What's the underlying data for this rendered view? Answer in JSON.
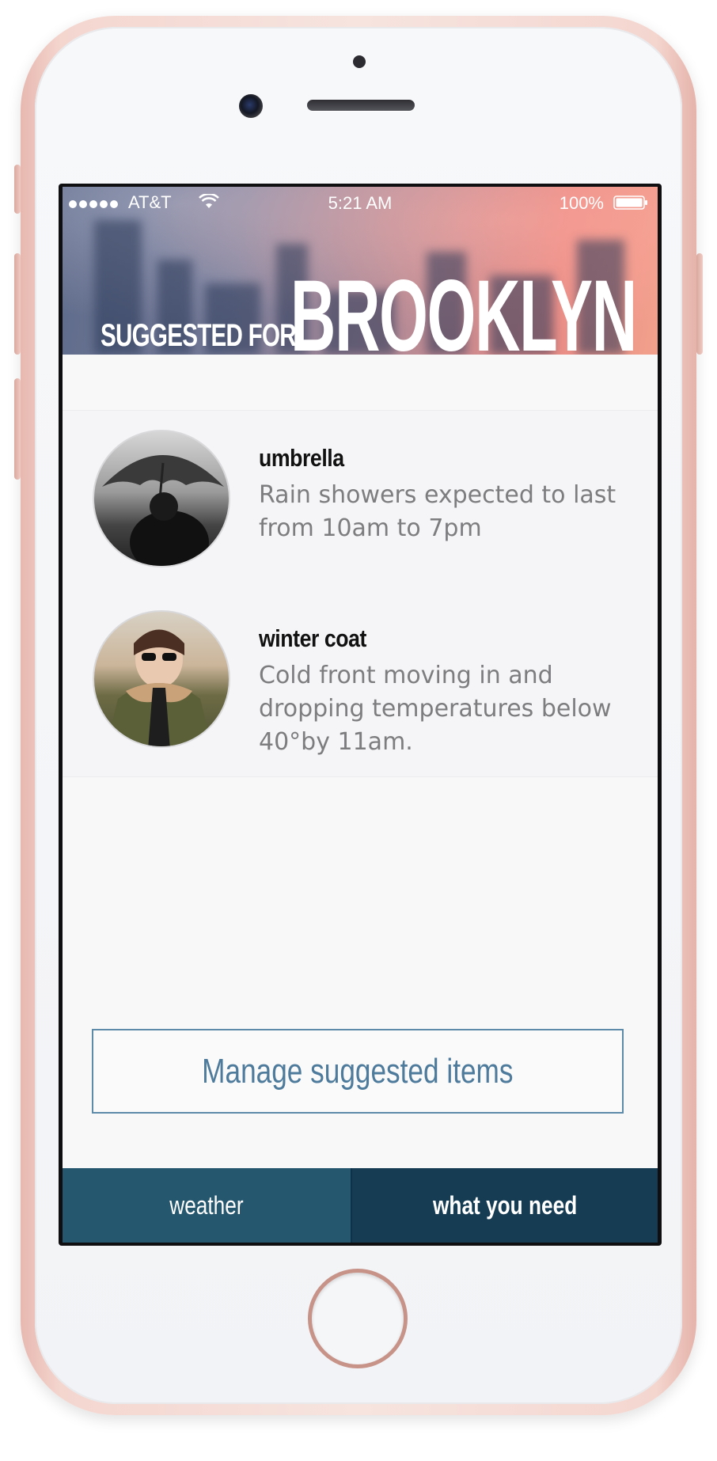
{
  "status_bar": {
    "carrier": "AT&T",
    "time": "5:21 AM",
    "battery": "100%"
  },
  "header": {
    "prefix": "SUGGESTED FOR",
    "city": "BROOKLYN"
  },
  "suggestions": [
    {
      "title": "umbrella",
      "description": "Rain showers expected to last from 10am to 7pm",
      "image": "umbrella-photo"
    },
    {
      "title": "winter coat",
      "description": "Cold front moving in and dropping temperatures below 40°by 11am.",
      "image": "winter-coat-photo"
    }
  ],
  "manage_button": {
    "label": "Manage suggested items"
  },
  "tabs": [
    {
      "label": "weather",
      "active": false
    },
    {
      "label": "what you need",
      "active": true
    }
  ],
  "colors": {
    "accent": "#4e7b9b",
    "tab_inactive": "#25576f",
    "tab_active": "#163c54",
    "frame": "#f4d6cf"
  }
}
